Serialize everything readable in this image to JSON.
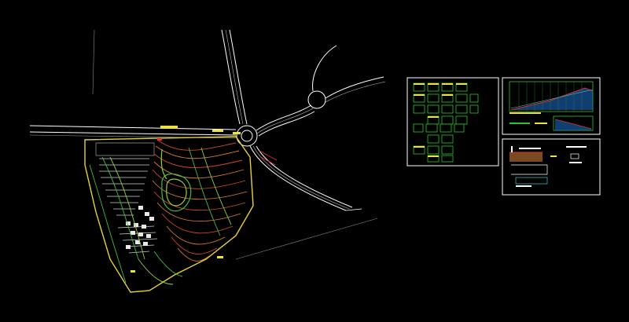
{
  "app": {
    "title": "",
    "background": "#000000"
  },
  "drawing": {
    "site_plan": {
      "label": "site-plan",
      "boundary_color": "#e6d23c"
    },
    "roads": {
      "color": "#ffffff"
    },
    "contours": {
      "colors": [
        "#d24a1e",
        "#e07a2a",
        "#3fbf3f",
        "#8bd13a",
        "#e6d23c"
      ]
    },
    "sheets": [
      {
        "id": "house-types-sheet"
      },
      {
        "id": "profile-sheet"
      },
      {
        "id": "detail-sheet"
      }
    ]
  },
  "colors": {
    "frame": "#ffffff",
    "accent_green": "#28c828",
    "accent_red": "#e03030",
    "accent_yellow": "#f0e040",
    "accent_cyan": "#40d0e0",
    "accent_magenta": "#d040d0"
  }
}
